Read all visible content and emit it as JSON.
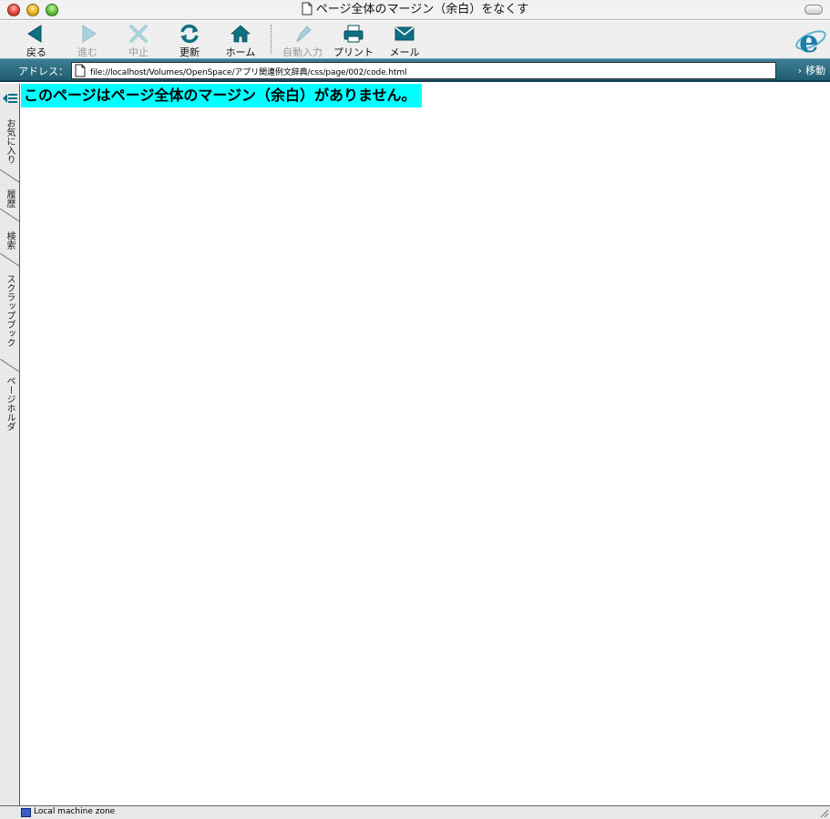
{
  "window": {
    "title": "ページ全体のマージン（余白）をなくす"
  },
  "toolbar": {
    "back": "戻る",
    "forward": "進む",
    "stop": "中止",
    "refresh": "更新",
    "home": "ホーム",
    "autofill": "自動入力",
    "print": "プリント",
    "mail": "メール"
  },
  "address": {
    "label": "アドレス：",
    "url": "file://localhost/Volumes/OpenSpace/アプリ関連例文辞典/css/page/002/code.html",
    "go": "移動"
  },
  "sidebar": {
    "tabs": [
      "お気に入り",
      "履歴",
      "検索",
      "スクラップブック",
      "ページホルダ"
    ]
  },
  "content": {
    "text": "このページはページ全体のマージン（余白）がありません。"
  },
  "status": {
    "text": "Local machine zone"
  },
  "colors": {
    "highlight": "#00ffff",
    "address_bar": "#2a6a80",
    "icon_teal": "#0f6f83"
  }
}
